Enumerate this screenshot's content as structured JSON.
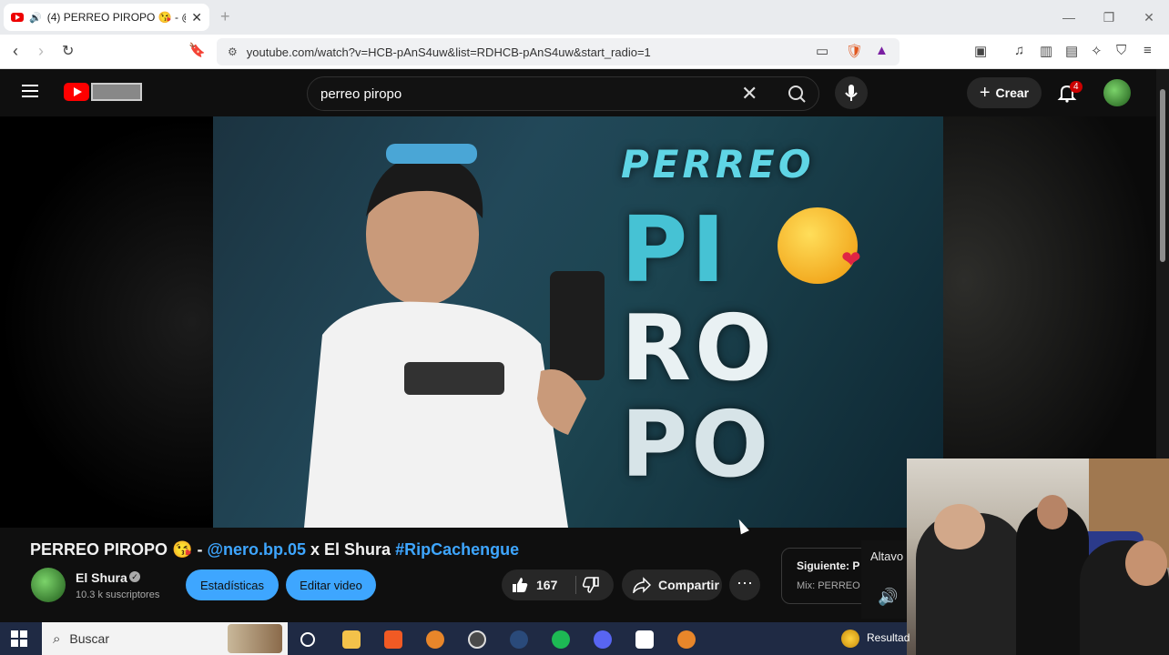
{
  "browser": {
    "tab_title": "(4) PERREO PIROPO 😘 - @n",
    "new_tab": "+",
    "url": "youtube.com/watch?v=HCB-pAnS4uw&list=RDHCB-pAnS4uw&start_radio=1"
  },
  "youtube_header": {
    "search_query": "perreo piropo",
    "create_label": "Crear",
    "notification_count": "4"
  },
  "video": {
    "thumb_words": [
      "PERREO",
      "PI",
      "RO",
      "PO"
    ],
    "title_prefix": "PERREO PIROPO 😘 - ",
    "title_mention": "@nero.bp.05",
    "title_middle": " x El Shura ",
    "title_hashtag": "#RipCachengue",
    "channel_name": "El Shura",
    "channel_verified_mark": "✓",
    "subscribers": "10.3 k suscriptores",
    "stats_button": "Estadísticas",
    "edit_button": "Editar video",
    "like_count": "167",
    "share_label": "Compartir",
    "more_label": "⋯",
    "next_label": "Siguiente: P",
    "next_sub": "Mix: PERREO P",
    "speaker_label": "Altavo"
  },
  "taskbar": {
    "search_placeholder": "Buscar",
    "tray_text": "Resultad"
  },
  "colors": {
    "yt_red": "#ff0000",
    "link_blue": "#3ea6ff",
    "dark_bg": "#0f0f0f"
  }
}
